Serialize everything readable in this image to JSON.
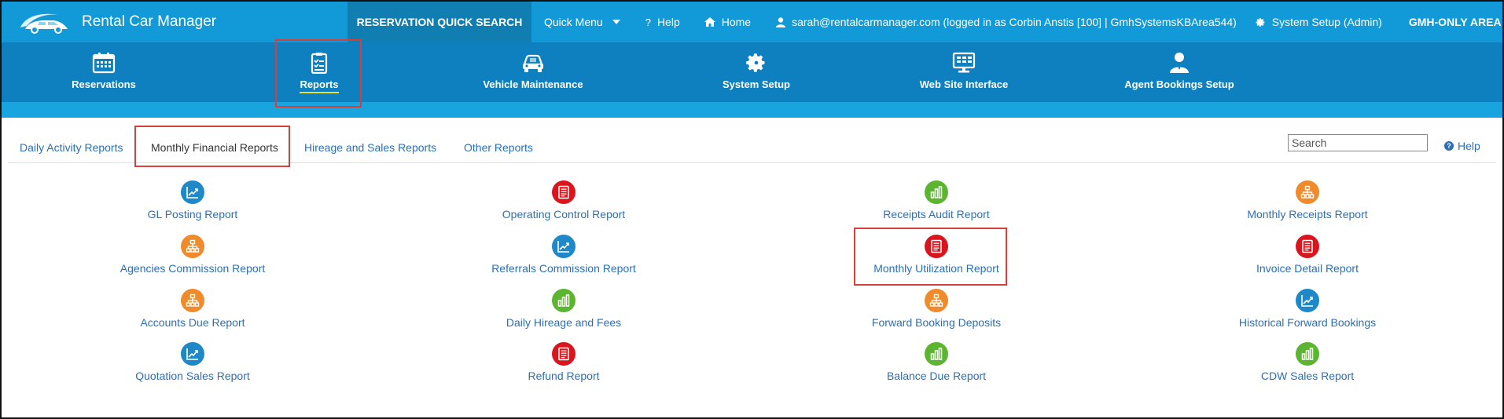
{
  "app": {
    "title": "Rental Car Manager"
  },
  "topnav": {
    "quick_search": "RESERVATION QUICK SEARCH",
    "quick_menu": "Quick Menu",
    "help": "Help",
    "home": "Home",
    "user": "sarah@rentalcarmanager.com (logged in as Corbin Anstis [100] | GmhSystemsKBArea544)",
    "system_setup": "System Setup (Admin)",
    "gmh_only": "GMH-ONLY AREA"
  },
  "modules": [
    {
      "label": "Reservations",
      "icon": "calendar-icon"
    },
    {
      "label": "Reports",
      "icon": "clipboard-icon",
      "active": true
    },
    {
      "label": "Vehicle Maintenance",
      "icon": "car-icon"
    },
    {
      "label": "System Setup",
      "icon": "gear-icon"
    },
    {
      "label": "Web Site Interface",
      "icon": "monitor-icon"
    },
    {
      "label": "Agent Bookings Setup",
      "icon": "agent-icon"
    }
  ],
  "tabs": [
    {
      "label": "Daily Activity Reports"
    },
    {
      "label": "Monthly Financial Reports",
      "active": true
    },
    {
      "label": "Hireage and Sales Reports"
    },
    {
      "label": "Other Reports"
    }
  ],
  "search": {
    "placeholder": "Search"
  },
  "help_link": "Help",
  "colors": {
    "topbar": "#119ad7",
    "modbar": "#0f80bf",
    "link": "#2a6fb8",
    "highlight": "#d6403a",
    "icon_blue": "#1f88c8",
    "icon_red": "#d9151e",
    "icon_green": "#5cb531",
    "icon_orange": "#f08a2b"
  },
  "reports": [
    {
      "label": "GL Posting Report",
      "icon": "chart-trend-icon",
      "color": "blue"
    },
    {
      "label": "Operating Control Report",
      "icon": "document-icon",
      "color": "red"
    },
    {
      "label": "Receipts Audit Report",
      "icon": "bar-chart-icon",
      "color": "green"
    },
    {
      "label": "Monthly Receipts Report",
      "icon": "hierarchy-icon",
      "color": "orange"
    },
    {
      "label": "Agencies Commission Report",
      "icon": "hierarchy-icon",
      "color": "orange"
    },
    {
      "label": "Referrals Commission Report",
      "icon": "chart-trend-icon",
      "color": "blue"
    },
    {
      "label": "Monthly Utilization Report",
      "icon": "document-icon",
      "color": "red"
    },
    {
      "label": "Invoice Detail Report",
      "icon": "document-icon",
      "color": "red"
    },
    {
      "label": "Accounts Due Report",
      "icon": "hierarchy-icon",
      "color": "orange"
    },
    {
      "label": "Daily Hireage and Fees",
      "icon": "bar-chart-icon",
      "color": "green"
    },
    {
      "label": "Forward Booking Deposits",
      "icon": "hierarchy-icon",
      "color": "orange"
    },
    {
      "label": "Historical Forward Bookings",
      "icon": "chart-trend-icon",
      "color": "blue"
    },
    {
      "label": "Quotation Sales Report",
      "icon": "chart-trend-icon",
      "color": "blue"
    },
    {
      "label": "Refund Report",
      "icon": "document-icon",
      "color": "red"
    },
    {
      "label": "Balance Due Report",
      "icon": "bar-chart-icon",
      "color": "green"
    },
    {
      "label": "CDW Sales Report",
      "icon": "bar-chart-icon",
      "color": "green"
    }
  ]
}
